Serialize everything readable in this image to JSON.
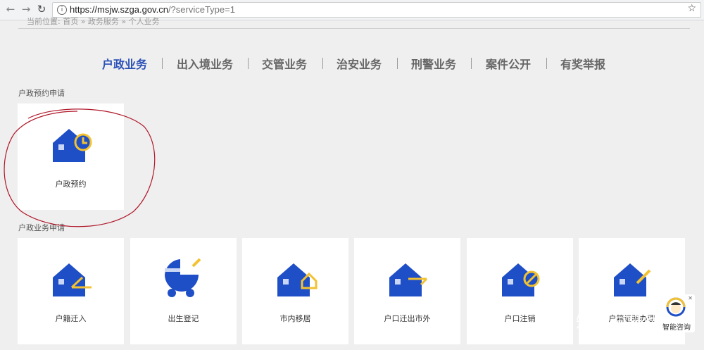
{
  "browser": {
    "url_main": "https://msjw.szga.gov.cn",
    "url_rest": "/?serviceType=1"
  },
  "breadcrumb": "当前位置:  首页  » 政务服务  » 个人业务",
  "tabs": [
    {
      "label": "户政业务",
      "active": true
    },
    {
      "label": "出入境业务",
      "active": false
    },
    {
      "label": "交管业务",
      "active": false
    },
    {
      "label": "治安业务",
      "active": false
    },
    {
      "label": "刑警业务",
      "active": false
    },
    {
      "label": "案件公开",
      "active": false
    },
    {
      "label": "有奖举报",
      "active": false
    }
  ],
  "section1": {
    "title": "户政预约申请",
    "cards": [
      {
        "label": "户政预约",
        "icon": "house-clock-icon"
      }
    ]
  },
  "section2": {
    "title": "户政业务申请",
    "cards": [
      {
        "label": "户籍迁入",
        "icon": "house-arrow-in-icon"
      },
      {
        "label": "出生登记",
        "icon": "baby-stroller-icon"
      },
      {
        "label": "市内移居",
        "icon": "house-move-icon"
      },
      {
        "label": "户口迁出市外",
        "icon": "house-arrow-out-icon"
      },
      {
        "label": "户口注销",
        "icon": "house-cancel-icon"
      },
      {
        "label": "户籍证明办理",
        "icon": "house-pen-icon"
      }
    ]
  },
  "watermark": "知乎 @軒然",
  "helper": {
    "label": "智能咨询",
    "icon": "support-agent-icon"
  },
  "colors": {
    "brand_blue": "#1f4fc6",
    "accent_yellow": "#f2c230",
    "active_tab": "#2a4fb6",
    "annotation_red": "#b0182a"
  }
}
